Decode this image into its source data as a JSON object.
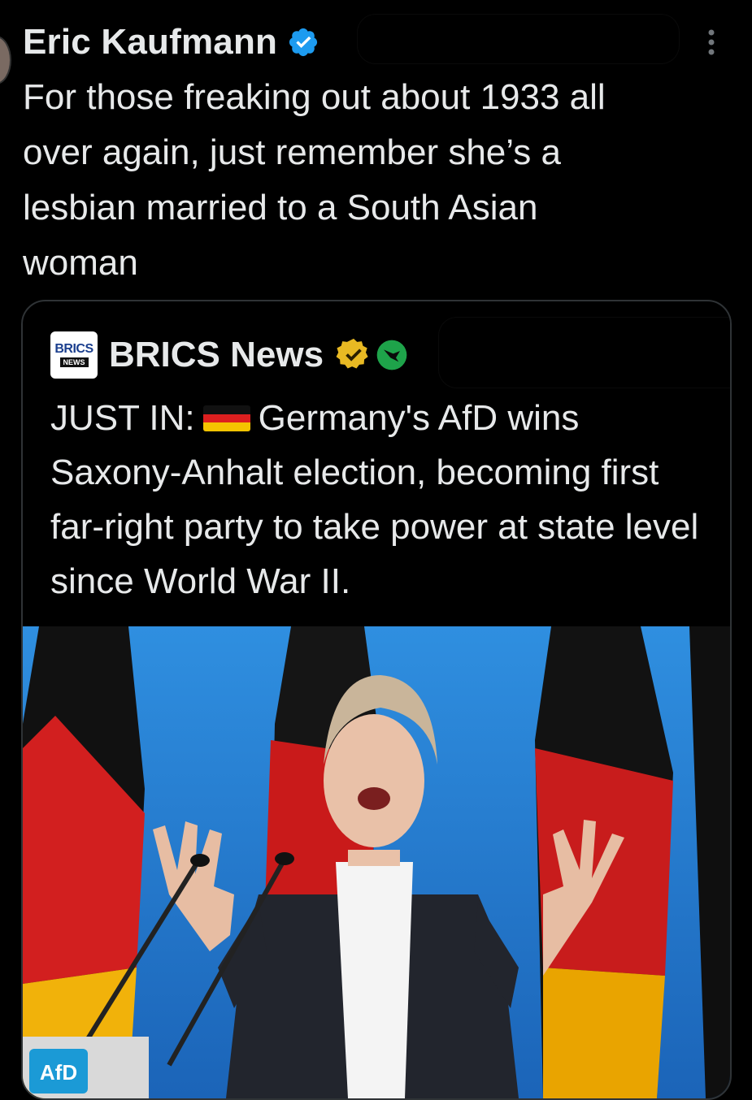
{
  "tweet": {
    "author_name": "Eric Kaufmann",
    "verified_icon": "blue-check-icon",
    "text": "For those freaking out about 1933 all\nover again, just remember she’s a\nlesbian married to a South Asian\nwoman"
  },
  "quote": {
    "logo_text_top": "BRICS",
    "logo_text_bottom": "NEWS",
    "author_name": "BRICS News",
    "text_prefix": "JUST IN:",
    "text_body": "Germany's AfD wins Saxony-Anhalt election, becoming first far-right party to take power at state level since World War II.",
    "image": {
      "podium_logo_text": "AfD"
    }
  },
  "colors": {
    "background": "#000000",
    "text": "#e7e9ea",
    "verified_blue": "#1d9bf0",
    "gold_badge": "#e8b923",
    "green_badge": "#1ea34a",
    "card_border": "#2f3336"
  }
}
